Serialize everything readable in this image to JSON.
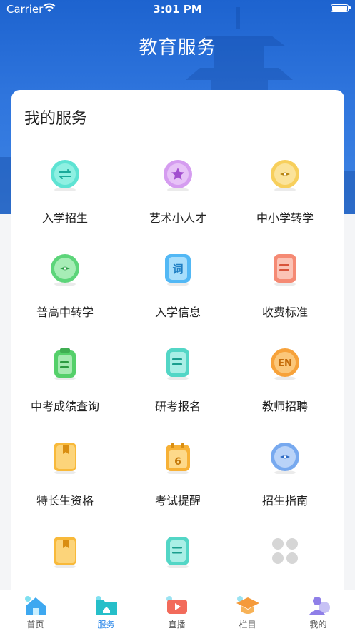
{
  "status_bar": {
    "carrier": "Carrier",
    "time": "3:01 PM"
  },
  "header": {
    "title": "教育服务"
  },
  "services": {
    "section_title": "我的服务",
    "items": [
      {
        "label": "入学招生",
        "icon": "swap-icon"
      },
      {
        "label": "艺术小人才",
        "icon": "star-icon"
      },
      {
        "label": "中小学转学",
        "icon": "compass-icon"
      },
      {
        "label": "普高中转学",
        "icon": "compass-icon"
      },
      {
        "label": "入学信息",
        "icon": "dictionary-icon"
      },
      {
        "label": "收费标准",
        "icon": "document-icon"
      },
      {
        "label": "中考成绩查询",
        "icon": "clipboard-icon"
      },
      {
        "label": "研考报名",
        "icon": "document-icon"
      },
      {
        "label": "教师招聘",
        "icon": "en-badge-icon"
      },
      {
        "label": "特长生资格",
        "icon": "bookmark-book-icon"
      },
      {
        "label": "考试提醒",
        "icon": "calendar-icon"
      },
      {
        "label": "招生指南",
        "icon": "compass-icon"
      },
      {
        "label": "",
        "icon": "bookmark-book-icon"
      },
      {
        "label": "",
        "icon": "document-icon"
      },
      {
        "label": "",
        "icon": "more-grid-icon"
      }
    ],
    "calendar_day": "6",
    "en_text": "EN",
    "dict_char": "词"
  },
  "tab_bar": {
    "tabs": [
      {
        "label": "首页",
        "icon": "home-icon"
      },
      {
        "label": "服务",
        "icon": "folder-icon",
        "active": true
      },
      {
        "label": "直播",
        "icon": "tv-play-icon"
      },
      {
        "label": "栏目",
        "icon": "graduation-cap-icon"
      },
      {
        "label": "我的",
        "icon": "user-icon"
      }
    ]
  },
  "colors": {
    "active_tab": "#2a86e8",
    "hero_blue": "#2f75dd"
  }
}
